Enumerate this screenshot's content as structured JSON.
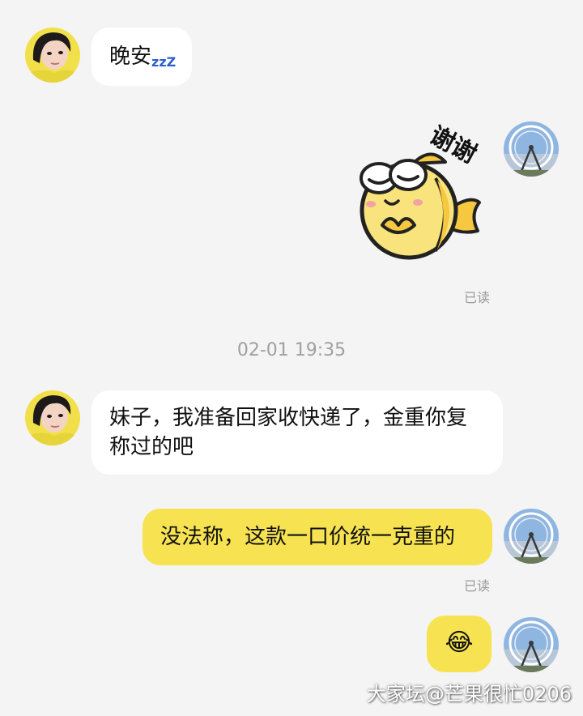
{
  "messages": [
    {
      "sender": "other",
      "text": "晚安",
      "suffix": "zzZ"
    },
    {
      "sender": "me",
      "sticker_text": "谢谢",
      "read": "已读"
    },
    {
      "sender": "other",
      "text": "妹子，我准备回家收快递了，金重你复称过的吧"
    },
    {
      "sender": "me",
      "text": "没法称，这款一口价统一克重的",
      "read": "已读"
    },
    {
      "sender": "me",
      "emoji": "😂"
    }
  ],
  "timestamp": "02-01 19:35",
  "watermark": "大家坛@芒果很忙0206",
  "colors": {
    "background": "#f4f4f4",
    "bubble_other": "#ffffff",
    "bubble_me": "#f7e352",
    "read_text": "#9a9a9a"
  },
  "icons": {
    "other_avatar": "girl-portrait-avatar",
    "my_avatar": "ferris-wheel-avatar",
    "sticker": "yellow-fish-sticker"
  }
}
